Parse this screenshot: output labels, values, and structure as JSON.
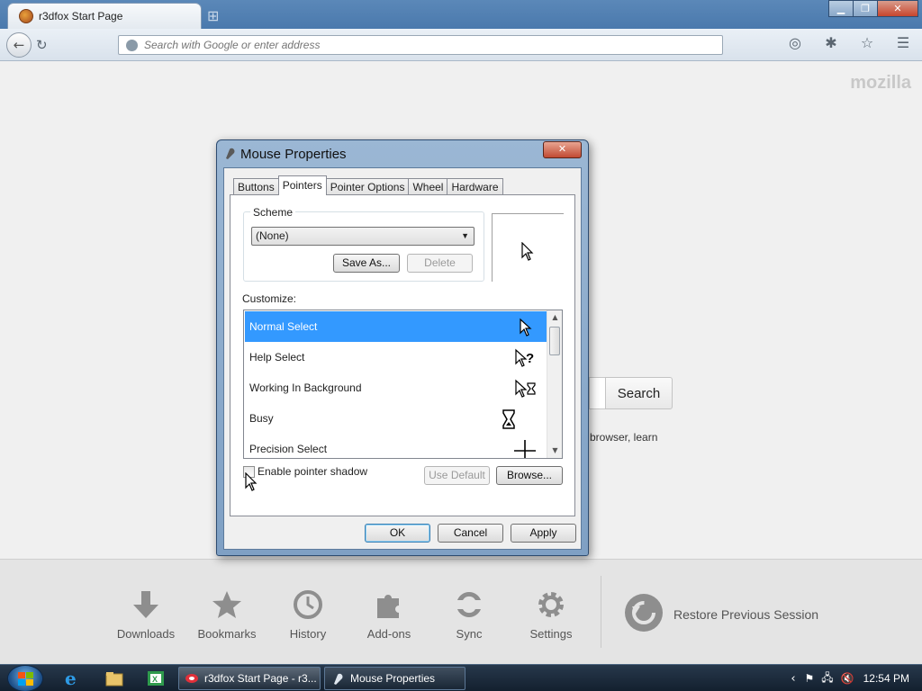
{
  "browser": {
    "tab_title": "r3dfox Start Page",
    "url_placeholder": "Search with Google or enter address",
    "logo_text": "mozilla",
    "search_button": "Search",
    "snippet_text": "browser, learn",
    "launcher": [
      {
        "label": "Downloads",
        "icon": "download-icon"
      },
      {
        "label": "Bookmarks",
        "icon": "star-icon"
      },
      {
        "label": "History",
        "icon": "clock-icon"
      },
      {
        "label": "Add-ons",
        "icon": "puzzle-icon"
      },
      {
        "label": "Sync",
        "icon": "sync-icon"
      },
      {
        "label": "Settings",
        "icon": "gear-icon"
      }
    ],
    "restore_label": "Restore Previous Session"
  },
  "dialog": {
    "title": "Mouse Properties",
    "tabs": [
      "Buttons",
      "Pointers",
      "Pointer Options",
      "Wheel",
      "Hardware"
    ],
    "active_tab": "Pointers",
    "scheme_label": "Scheme",
    "scheme_value": "(None)",
    "save_as": "Save As...",
    "delete": "Delete",
    "customize_label": "Customize:",
    "cursors": [
      {
        "label": "Normal Select",
        "icon": "arrow-cursor-icon",
        "selected": true
      },
      {
        "label": "Help Select",
        "icon": "help-cursor-icon",
        "selected": false
      },
      {
        "label": "Working In Background",
        "icon": "busy-background-cursor-icon",
        "selected": false
      },
      {
        "label": "Busy",
        "icon": "hourglass-cursor-icon",
        "selected": false
      },
      {
        "label": "Precision Select",
        "icon": "crosshair-cursor-icon",
        "selected": false
      }
    ],
    "shadow_label": "Enable pointer shadow",
    "shadow_checked": false,
    "use_default": "Use Default",
    "browse": "Browse...",
    "ok": "OK",
    "cancel": "Cancel",
    "apply": "Apply"
  },
  "taskbar": {
    "tasks": [
      {
        "label": "r3dfox Start Page - r3...",
        "active": false
      },
      {
        "label": "Mouse Properties",
        "active": true
      }
    ],
    "clock": "12:54 PM"
  }
}
